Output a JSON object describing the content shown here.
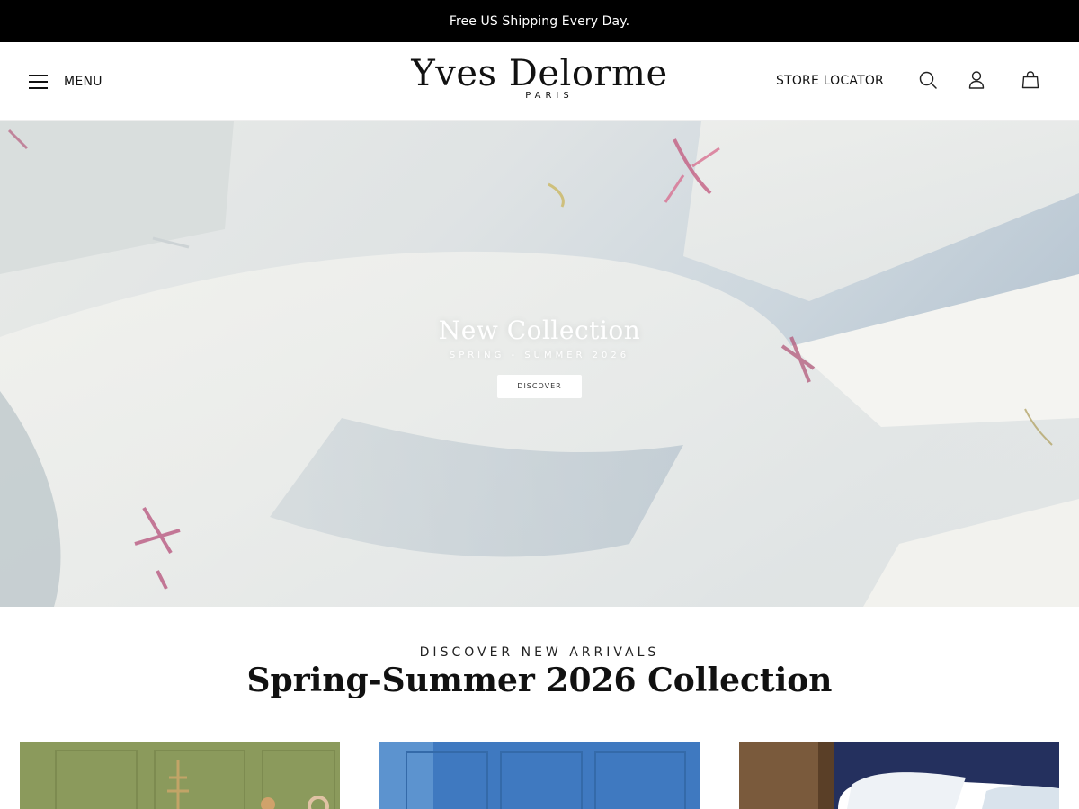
{
  "announcement": {
    "text": "Free US Shipping Every Day."
  },
  "header": {
    "menu_label": "MENU",
    "menu_icon": "hamburger-icon",
    "logo_name": "Yves Delorme",
    "logo_city": "PARIS",
    "store_locator_label": "STORE LOCATOR",
    "icons": [
      "search-icon",
      "account-icon",
      "shopping-bag-icon"
    ]
  },
  "hero": {
    "title": "New Collection",
    "subtitle": "SPRING - SUMMER 2026",
    "button_label": "DISCOVER"
  },
  "arrivals": {
    "eyebrow": "DISCOVER NEW ARRIVALS",
    "title": "Spring-Summer 2026 Collection"
  },
  "colors": {
    "announcement_bg": "#000000",
    "tile_1": "#8b9a5c",
    "tile_2": "#3f79c0",
    "tile_3": "#24305e"
  }
}
